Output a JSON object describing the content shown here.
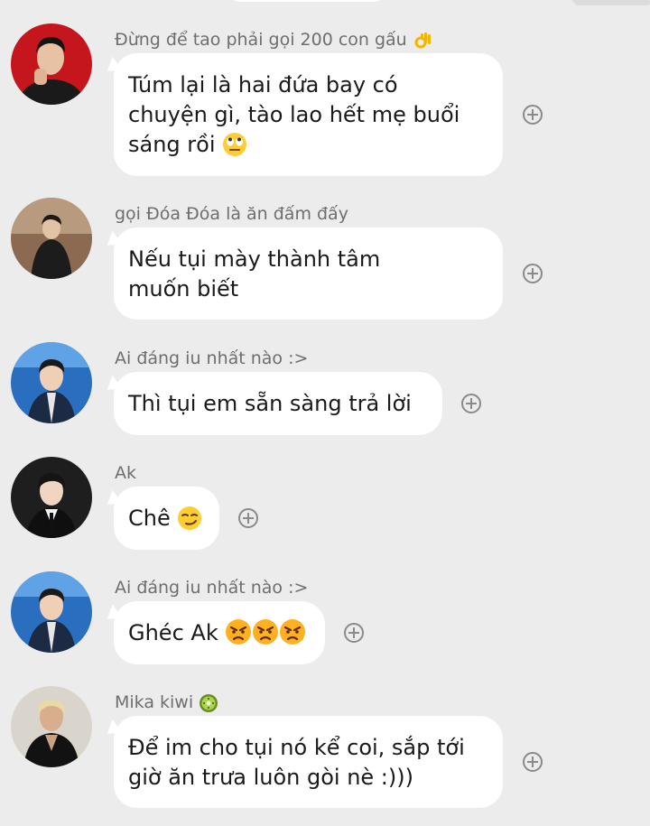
{
  "messages": [
    {
      "sender": "Đừng để tao phải gọi 200 con gấu",
      "sender_emoji": "ok-hand-emoji",
      "text": "Túm lại là hai đứa bay có\nchuyện gì, tào lao hết mẹ buổi\nsáng rồi",
      "text_emoji": "eye-roll-emoji",
      "avatar": "red-background-portrait"
    },
    {
      "sender": "gọi Đóa Đóa là ăn đấm đấy",
      "text": "Nếu tụi mày thành tâm\nmuốn biết",
      "avatar": "outdoor-dark-coat-portrait"
    },
    {
      "sender": "Ai đáng iu nhất nào :>",
      "text": "Thì tụi em sẵn sàng trả lời",
      "avatar": "blue-background-portrait"
    },
    {
      "sender": "Ak",
      "text": "Chê",
      "text_emoji": "smirk-emoji",
      "avatar": "suit-dark-background-portrait"
    },
    {
      "sender": "Ai đáng iu nhất nào :>",
      "text": "Ghéc Ak",
      "text_emoji": "angry-face-emoji-x3",
      "avatar": "blue-background-portrait"
    },
    {
      "sender": "Mika kiwi",
      "sender_emoji": "kiwi-emoji",
      "text": "Để im cho tụi nó kể coi, sắp tới\ngiờ ăn trưa luôn gòi nè :)))",
      "avatar": "blonde-dark-coat-portrait"
    }
  ],
  "colors": {
    "background": "#ececec",
    "bubble": "#ffffff",
    "sender_text": "#6e6e6e",
    "message_text": "#1a1a1a",
    "add_icon": "#8a8a8a"
  }
}
